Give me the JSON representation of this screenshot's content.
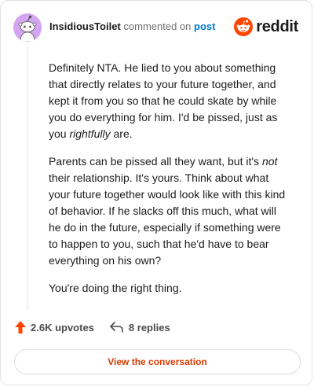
{
  "header": {
    "username": "InsidiousToilet",
    "action": "commented on",
    "post_link": "post"
  },
  "brand": {
    "wordmark": "reddit",
    "icon": "reddit-alien-icon",
    "color": "#ff4500"
  },
  "avatar": {
    "icon": "snoo-avatar-icon",
    "background": "#d4a5f2"
  },
  "comment": {
    "p1_a": "Definitely NTA. He lied to you about something that directly relates to your future together, and kept it from you so that he could skate by while you do everything for him. I'd be pissed, just as you ",
    "p1_em": "rightfully",
    "p1_b": " are.",
    "p2_a": "Parents can be pissed all they want, but it's ",
    "p2_em": "not",
    "p2_b": " their relationship. It's yours. Think about what your future together would look like with this kind of behavior. If he slacks off this much, what will he do in the future, especially if something were to happen to you, such that he'd have to bear everything on his own?",
    "p3": "You're doing the right thing."
  },
  "footer": {
    "upvotes": "2.6K upvotes",
    "upvote_icon": "upvote-arrow-icon",
    "upvote_color": "#ff4500",
    "replies": "8 replies",
    "reply_icon": "reply-arrow-icon"
  },
  "cta": {
    "label": "View the conversation",
    "color": "#d93a00"
  }
}
